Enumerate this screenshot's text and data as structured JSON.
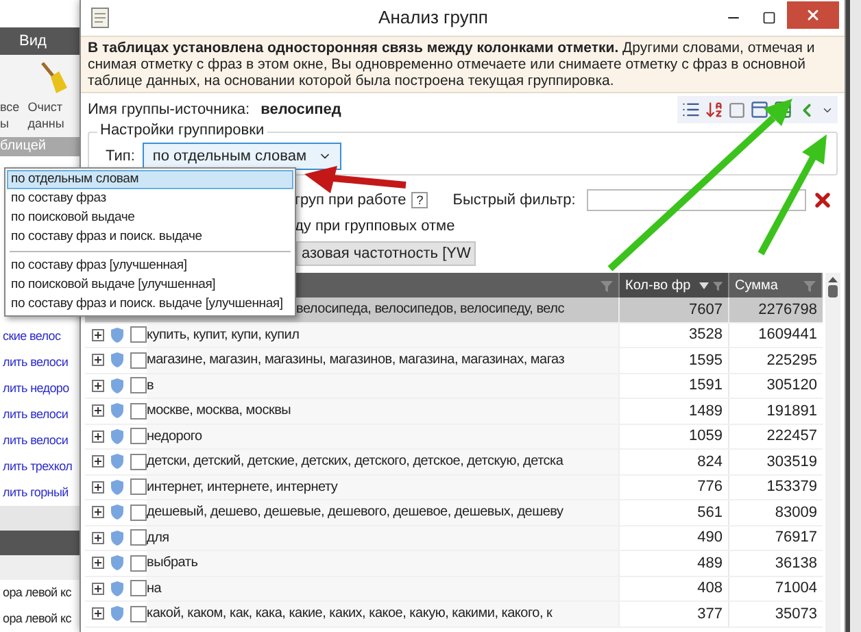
{
  "background_app": {
    "menu_tab": "Вид",
    "ribbon_columns": [
      {
        "kind": "text",
        "lines": [
          "все",
          "ы"
        ]
      },
      {
        "kind": "icon",
        "lines": [
          "Очист",
          "данны"
        ]
      }
    ],
    "ribbon_group": "блицей",
    "links": [
      "ские велос",
      "лить велоси",
      "лить недоро",
      "лить велоси",
      "лить велоси",
      "лить трехкол",
      "лить горный"
    ],
    "rows": [
      "ора левой кс",
      "ора левой кс"
    ]
  },
  "window": {
    "title": "Анализ групп"
  },
  "notice": "**В таблицах установлена односторонняя связь между колонками отметки.** Другими словами, отмечая и снимая отметку с фраз в этом окне, Вы одновременно отмечаете или снимаете отметку с фраз в основной таблице данных, на основании которой была построена текущая группировка.",
  "source_group": {
    "label": "Имя группы-источника:",
    "value": "велосипед"
  },
  "grouping": {
    "title": "Настройки группировки",
    "type_label": "Тип:",
    "type_value": "по отдельным словам",
    "open": true,
    "options": [
      {
        "kind": "option",
        "label": "по отдельным словам",
        "selected": true
      },
      {
        "kind": "option",
        "label": "по составу фраз",
        "selected": false
      },
      {
        "kind": "option",
        "label": "по поисковой выдаче",
        "selected": false
      },
      {
        "kind": "option",
        "label": "по составу фраз и поиск. выдаче",
        "selected": false
      },
      {
        "kind": "separator"
      },
      {
        "kind": "option",
        "label": "по составу фраз [улучшенная]",
        "selected": false
      },
      {
        "kind": "option",
        "label": "по поисковой выдаче [улучшенная]",
        "selected": false
      },
      {
        "kind": "option",
        "label": "по составу фраз и поиск. выдаче [улучшенная]",
        "selected": false
      }
    ]
  },
  "options_text": "груп при работе",
  "help": "?",
  "quick_filter": {
    "label": "Быстрый фильтр:"
  },
  "option_line": "ду при групповых отме",
  "frequency_button": "азовая частотность [YW",
  "table": {
    "columns": [
      {
        "sorted": false
      },
      {
        "label": "Кол-во фр",
        "sorted": true
      },
      {
        "label": "Сумма",
        "sorted": false
      }
    ],
    "rows": [
      {
        "kind": "covered",
        "text": "велосипеда, велосипедов, велосипеду, велс",
        "count": "7607",
        "sum": "2276798",
        "selected": true
      },
      {
        "kind": "full",
        "text": "купить, купит, купи, купил",
        "count": "3528",
        "sum": "1609441",
        "selected": false,
        "checked": false
      },
      {
        "kind": "full",
        "text": "магазине, магазин, магазины, магазинов, магазина, магазинах, магаз",
        "count": "1595",
        "sum": "225295",
        "selected": false,
        "checked": false
      },
      {
        "kind": "full",
        "text": "в",
        "count": "1591",
        "sum": "305120",
        "selected": false,
        "checked": false
      },
      {
        "kind": "full",
        "text": "москве, москва, москвы",
        "count": "1489",
        "sum": "191891",
        "selected": false,
        "checked": false
      },
      {
        "kind": "full",
        "text": "недорого",
        "count": "1059",
        "sum": "222457",
        "selected": false,
        "checked": false
      },
      {
        "kind": "full",
        "text": "детски, детский, детские, детских, детского, детское, детскую, детска",
        "count": "824",
        "sum": "303519",
        "selected": false,
        "checked": false
      },
      {
        "kind": "full",
        "text": "интернет, интернете, интернету",
        "count": "776",
        "sum": "153379",
        "selected": false,
        "checked": false
      },
      {
        "kind": "full",
        "text": "дешевый, дешево, дешевые, дешевого, дешевое, дешевых, дешеву",
        "count": "561",
        "sum": "83009",
        "selected": false,
        "checked": false
      },
      {
        "kind": "full",
        "text": "для",
        "count": "490",
        "sum": "76917",
        "selected": false,
        "checked": false
      },
      {
        "kind": "full",
        "text": "выбрать",
        "count": "489",
        "sum": "36138",
        "selected": false,
        "checked": false
      },
      {
        "kind": "full",
        "text": "на",
        "count": "408",
        "sum": "71004",
        "selected": false,
        "checked": false
      },
      {
        "kind": "full",
        "text": "какой, каком, как, кака, какие, каких, какое, какую, какими, какого, к",
        "count": "377",
        "sum": "35073",
        "selected": false,
        "checked": false
      }
    ]
  }
}
